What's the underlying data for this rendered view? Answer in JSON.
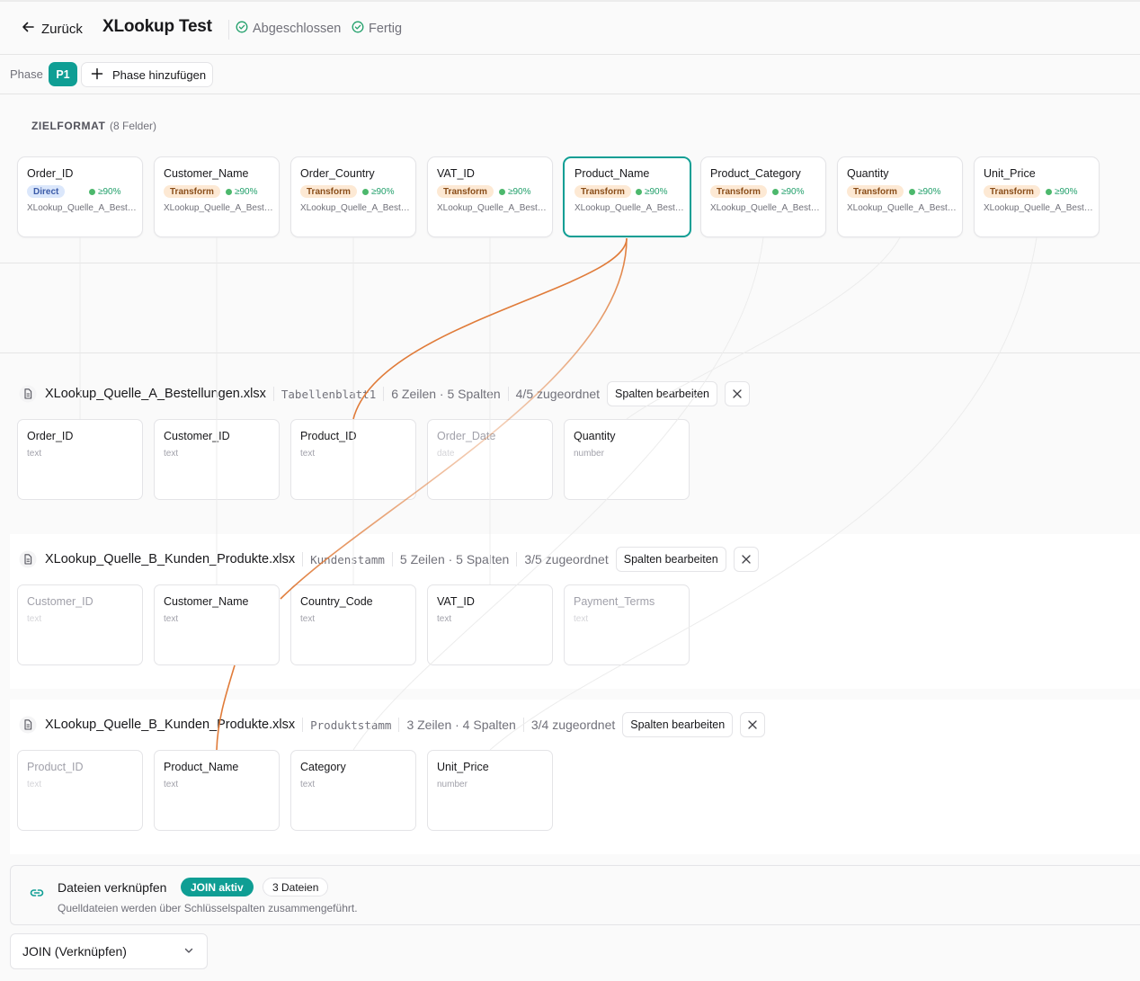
{
  "header": {
    "back_label": "Zurück",
    "title": "XLookup Test",
    "status_1": "Abgeschlossen",
    "status_2": "Fertig"
  },
  "phases": {
    "label": "Phase",
    "active": "P1",
    "add_label": "Phase hinzufügen"
  },
  "target_format": {
    "heading": "ZIELFORMAT",
    "count": "(8 Felder)",
    "fields": [
      {
        "name": "Order_ID",
        "mode": "Direct",
        "confidence": "≥90%",
        "source": "XLookup_Quelle_A_Bestellungen.xlsx"
      },
      {
        "name": "Customer_Name",
        "mode": "Transform",
        "confidence": "≥90%",
        "source": "XLookup_Quelle_A_Bestellungen.xlsx"
      },
      {
        "name": "Order_Country",
        "mode": "Transform",
        "confidence": "≥90%",
        "source": "XLookup_Quelle_A_Bestellungen.xlsx"
      },
      {
        "name": "VAT_ID",
        "mode": "Transform",
        "confidence": "≥90%",
        "source": "XLookup_Quelle_A_Bestellungen.xlsx"
      },
      {
        "name": "Product_Name",
        "mode": "Transform",
        "confidence": "≥90%",
        "source": "XLookup_Quelle_A_Bestellungen.xlsx",
        "selected": true
      },
      {
        "name": "Product_Category",
        "mode": "Transform",
        "confidence": "≥90%",
        "source": "XLookup_Quelle_A_Bestellungen.xlsx"
      },
      {
        "name": "Quantity",
        "mode": "Transform",
        "confidence": "≥90%",
        "source": "XLookup_Quelle_A_Bestellungen.xlsx"
      },
      {
        "name": "Unit_Price",
        "mode": "Transform",
        "confidence": "≥90%",
        "source": "XLookup_Quelle_A_Bestellungen.xlsx"
      }
    ]
  },
  "sources": [
    {
      "file": "XLookup_Quelle_A_Bestellungen.xlsx",
      "sheet": "Tabellenblatt1",
      "dims": "6 Zeilen · 5 Spalten",
      "mapped": "4/5 zugeordnet",
      "edit_label": "Spalten bearbeiten",
      "columns": [
        {
          "name": "Order_ID",
          "type": "text",
          "mapped": true
        },
        {
          "name": "Customer_ID",
          "type": "text",
          "mapped": true
        },
        {
          "name": "Product_ID",
          "type": "text",
          "mapped": true
        },
        {
          "name": "Order_Date",
          "type": "date",
          "mapped": false
        },
        {
          "name": "Quantity",
          "type": "number",
          "mapped": true
        }
      ]
    },
    {
      "file": "XLookup_Quelle_B_Kunden_Produkte.xlsx",
      "sheet": "Kundenstamm",
      "dims": "5 Zeilen · 5 Spalten",
      "mapped": "3/5 zugeordnet",
      "edit_label": "Spalten bearbeiten",
      "columns": [
        {
          "name": "Customer_ID",
          "type": "text",
          "mapped": false
        },
        {
          "name": "Customer_Name",
          "type": "text",
          "mapped": true
        },
        {
          "name": "Country_Code",
          "type": "text",
          "mapped": true
        },
        {
          "name": "VAT_ID",
          "type": "text",
          "mapped": true
        },
        {
          "name": "Payment_Terms",
          "type": "text",
          "mapped": false
        }
      ]
    },
    {
      "file": "XLookup_Quelle_B_Kunden_Produkte.xlsx",
      "sheet": "Produktstamm",
      "dims": "3 Zeilen · 4 Spalten",
      "mapped": "3/4 zugeordnet",
      "edit_label": "Spalten bearbeiten",
      "columns": [
        {
          "name": "Product_ID",
          "type": "text",
          "mapped": false
        },
        {
          "name": "Product_Name",
          "type": "text",
          "mapped": true
        },
        {
          "name": "Category",
          "type": "text",
          "mapped": true
        },
        {
          "name": "Unit_Price",
          "type": "number",
          "mapped": true
        }
      ]
    }
  ],
  "join": {
    "title": "Dateien verknüpfen",
    "badge": "JOIN aktiv",
    "files_badge": "3 Dateien",
    "description": "Quelldateien werden über Schlüsselspalten zusammengeführt.",
    "select_value": "JOIN (Verknüpfen)"
  },
  "colors": {
    "accent": "#0f9e94",
    "connection": "#e07b39",
    "confidence": "#4cb86c"
  }
}
